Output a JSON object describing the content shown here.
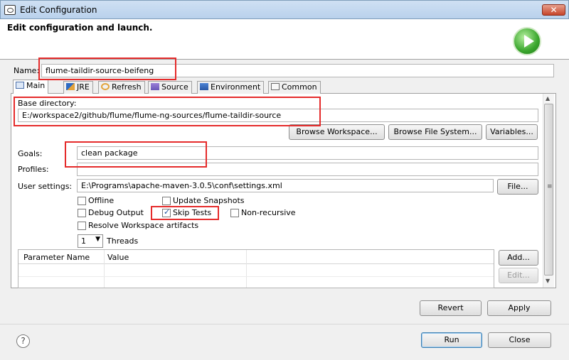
{
  "window": {
    "title": "Edit Configuration",
    "close_glyph": "✕"
  },
  "header": {
    "title": "Edit configuration and launch.",
    "icon": "run-icon"
  },
  "name": {
    "label": "Name:",
    "value": "flume-taildir-source-beifeng"
  },
  "tabs": [
    {
      "label": "Main",
      "icon": "main-tab-icon",
      "active": true
    },
    {
      "label": "JRE",
      "icon": "jre-icon"
    },
    {
      "label": "Refresh",
      "icon": "refresh-icon"
    },
    {
      "label": "Source",
      "icon": "source-icon"
    },
    {
      "label": "Environment",
      "icon": "environment-icon"
    },
    {
      "label": "Common",
      "icon": "common-icon"
    }
  ],
  "base_directory": {
    "label": "Base directory:",
    "value": "E:/workspace2/github/flume/flume-ng-sources/flume-taildir-source",
    "buttons": {
      "browse_workspace": "Browse Workspace...",
      "browse_file_system": "Browse File System...",
      "variables": "Variables..."
    }
  },
  "goals": {
    "label": "Goals:",
    "value": "clean package"
  },
  "profiles": {
    "label": "Profiles:",
    "value": ""
  },
  "user_settings": {
    "label": "User settings:",
    "value": "E:\\Programs\\apache-maven-3.0.5\\conf\\settings.xml",
    "button": "File..."
  },
  "options": {
    "offline": {
      "label": "Offline",
      "checked": false
    },
    "update_snapshots": {
      "label": "Update Snapshots",
      "checked": false
    },
    "debug_output": {
      "label": "Debug Output",
      "checked": false
    },
    "skip_tests": {
      "label": "Skip Tests",
      "checked": true
    },
    "non_recursive": {
      "label": "Non-recursive",
      "checked": false
    },
    "resolve_workspace": {
      "label": "Resolve Workspace artifacts",
      "checked": false
    }
  },
  "threads": {
    "value": "1",
    "label": "Threads"
  },
  "parameters": {
    "columns": [
      "Parameter Name",
      "Value"
    ],
    "rows": [],
    "add": "Add...",
    "edit": "Edit..."
  },
  "footer": {
    "revert": "Revert",
    "apply": "Apply",
    "run": "Run",
    "close": "Close",
    "help_glyph": "?"
  }
}
